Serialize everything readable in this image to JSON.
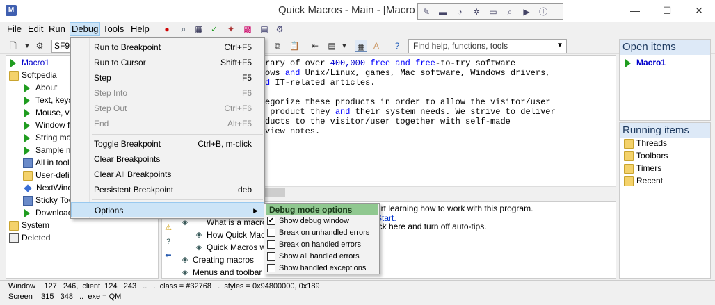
{
  "window": {
    "app_icon": "M",
    "title": "Quick Macros - Main - [Macro",
    "minimize": "—",
    "maximize": "☐",
    "close": "✕"
  },
  "floating_toolbar": {
    "icons": [
      "pen-icon",
      "keyboard-icon",
      "mouse-icon",
      "gear-icon",
      "window-icon",
      "find-icon",
      "run-icon",
      "info-icon"
    ]
  },
  "menubar": {
    "file": "File",
    "edit": "Edit",
    "run": "Run",
    "debug": "Debug",
    "tools": "Tools",
    "help": "Help"
  },
  "toolbar": {
    "macro_name": "SF9",
    "search_placeholder": "Find help, functions, tools"
  },
  "tree": {
    "items": [
      {
        "label": "Macro1",
        "icon": "play"
      },
      {
        "label": "Softpedia",
        "icon": "folder"
      },
      {
        "label": "About",
        "icon": "play"
      },
      {
        "label": "Text, keys",
        "icon": "play"
      },
      {
        "label": "Mouse, va",
        "icon": "play"
      },
      {
        "label": "Window f",
        "icon": "play"
      },
      {
        "label": "String ma",
        "icon": "play"
      },
      {
        "label": "Sample m",
        "icon": "play"
      },
      {
        "label": "All in tool",
        "icon": "toolbar"
      },
      {
        "label": "User-defir",
        "icon": "folder"
      },
      {
        "label": "NextWinc",
        "icon": "diamond"
      },
      {
        "label": "Sticky Toc",
        "icon": "toolbar"
      },
      {
        "label": "Downloac",
        "icon": "play"
      },
      {
        "label": "System",
        "icon": "folder"
      },
      {
        "label": "Deleted",
        "icon": "deleted"
      }
    ]
  },
  "editor": {
    "line1_a": "rary of over ",
    "line1_num": "400,000",
    "line1_b": " ",
    "line1_kw1": "free",
    "line1_c": " ",
    "line1_kw2": "and",
    "line1_d": " ",
    "line1_kw3": "free",
    "line1_e": "-to-try software",
    "line2_a": "ows ",
    "line2_kw": "and",
    "line2_b": " Unix/Linux, games, Mac software, Windows drivers,",
    "line3_kw": "d",
    "line3_b": " IT-related articles.",
    "line4": "egorize these products in order to allow the visitor/user",
    "line5_a": " product they ",
    "line5_kw": "and",
    "line5_b": " their system needs. We strive to deliver",
    "line6": "ducts to the visitor/user together with self-made",
    "line7": "view notes."
  },
  "helppane": {
    "line1": "art learning how to work with this program.",
    "line2_link": "Start.",
    "line3": "ick here and turn off auto-tips.",
    "topics": [
      "What is a macro",
      "How Quick Mac",
      "Quick Macros w",
      "Creating macros",
      "Menus and toolbar"
    ]
  },
  "open_items": {
    "header": "Open items",
    "items": [
      "Macro1"
    ]
  },
  "running_items": {
    "header": "Running items",
    "items": [
      "Threads",
      "Toolbars",
      "Timers",
      "Recent"
    ]
  },
  "status": {
    "line1": "Window    127   246,  client  124   243   ..   .  class = #32768   .  styles = 0x94800000, 0x189",
    "line2": "Screen    315   348   ..  exe = QM"
  },
  "debug_menu": {
    "items": [
      {
        "label": "Run to Breakpoint",
        "shortcut": "Ctrl+F5",
        "disabled": false
      },
      {
        "label": "Run to Cursor",
        "shortcut": "Shift+F5",
        "disabled": false
      },
      {
        "label": "Step",
        "shortcut": "F5",
        "disabled": false
      },
      {
        "label": "Step Into",
        "shortcut": "F6",
        "disabled": true
      },
      {
        "label": "Step Out",
        "shortcut": "Ctrl+F6",
        "disabled": true
      },
      {
        "label": "End",
        "shortcut": "Alt+F5",
        "disabled": true
      },
      {
        "label": "Toggle Breakpoint",
        "shortcut": "Ctrl+B, m-click",
        "disabled": false
      },
      {
        "label": "Clear Breakpoints",
        "shortcut": "",
        "disabled": false
      },
      {
        "label": "Clear All Breakpoints",
        "shortcut": "",
        "disabled": false
      },
      {
        "label": "Persistent Breakpoint",
        "shortcut": "deb",
        "disabled": false
      }
    ],
    "options": "Options"
  },
  "options_submenu": {
    "header": "Debug mode options",
    "items": [
      {
        "label": "Show debug window",
        "checked": true
      },
      {
        "label": "Break on unhandled errors",
        "checked": false
      },
      {
        "label": "Break on handled errors",
        "checked": false
      },
      {
        "label": "Show all handled errors",
        "checked": false
      },
      {
        "label": "Show handled exceptions",
        "checked": false
      }
    ]
  },
  "colors": {
    "accent": "#cce4f7",
    "keyword": "#0000ff",
    "play_green": "#1f9c1f",
    "submenu_header": "#90c890"
  }
}
